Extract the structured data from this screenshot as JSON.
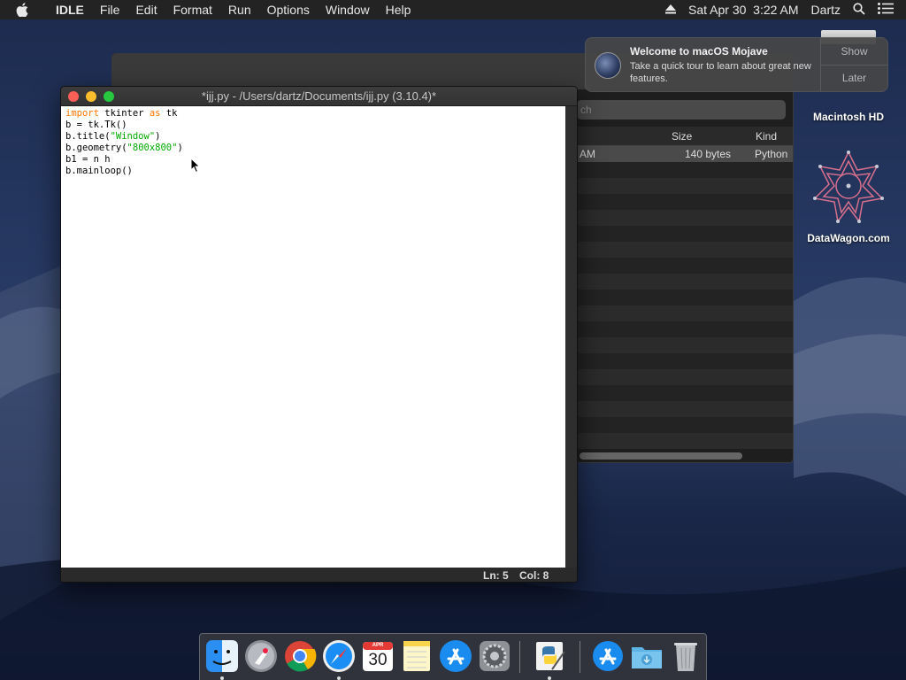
{
  "menubar": {
    "app_name": "IDLE",
    "menus": [
      "File",
      "Edit",
      "Format",
      "Run",
      "Options",
      "Window",
      "Help"
    ],
    "datetime": "Sat Apr 30  3:22 AM",
    "user": "Dartz"
  },
  "notification": {
    "title": "Welcome to macOS Mojave",
    "body": "Take a quick tour to learn about great new features.",
    "show_label": "Show",
    "later_label": "Later"
  },
  "desktop": {
    "hd_label": "Macintosh HD",
    "datawagon_label": "DataWagon.com"
  },
  "finder": {
    "search_placeholder": "ch",
    "columns": {
      "size": "Size",
      "kind": "Kind"
    },
    "row": {
      "date_tail": "AM",
      "size": "140 bytes",
      "kind": "Python S"
    }
  },
  "idle": {
    "title": "*ijj.py - /Users/dartz/Documents/ijj.py (3.10.4)*",
    "code": {
      "line1_kw1": "import",
      "line1_mid": " tkinter ",
      "line1_kw2": "as",
      "line1_end": " tk",
      "line2": "b = tk.Tk()",
      "line3_a": "b.title(",
      "line3_str": "\"Window\"",
      "line3_b": ")",
      "line4_a": "b.geometry(",
      "line4_str": "\"800x800\"",
      "line4_b": ")",
      "line5": "b1 = n h",
      "line6": "b.mainloop()"
    },
    "status": {
      "line": "Ln: 5",
      "col": "Col: 8"
    }
  },
  "dock": {
    "apps": [
      "finder-icon",
      "launchpad-icon",
      "chrome-icon",
      "safari-icon",
      "calendar-icon",
      "notes-icon",
      "app-store-icon",
      "system-preferences-icon",
      "python-idle-icon",
      "applications-folder-icon",
      "downloads-folder-icon",
      "trash-icon"
    ],
    "calendar_month": "APR",
    "calendar_day": "30"
  },
  "colors": {
    "keyword": "#ff7700",
    "string": "#00aa00",
    "close": "#fc5f57",
    "minimize": "#fdbc2e",
    "zoom": "#27c840"
  }
}
